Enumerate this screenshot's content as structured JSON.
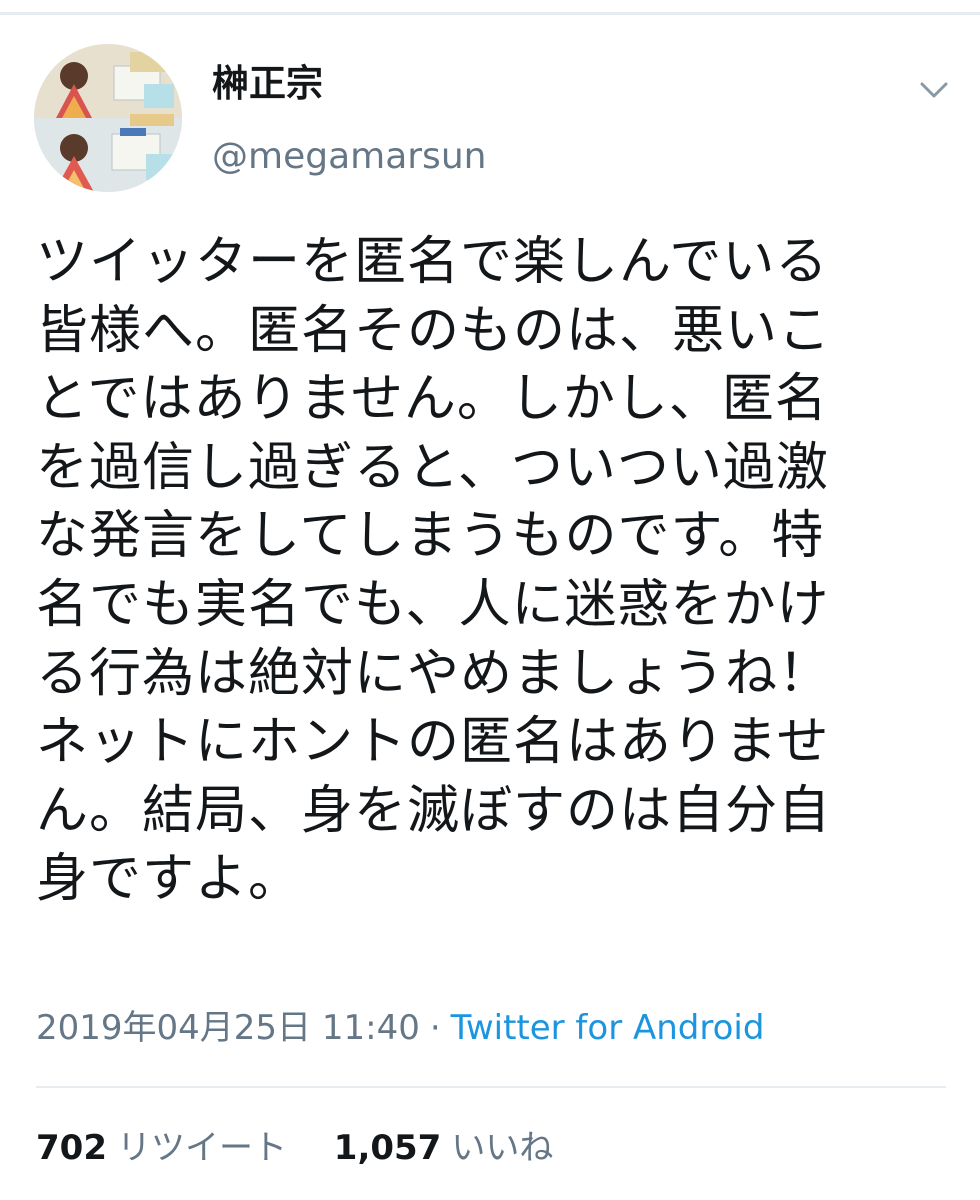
{
  "tweet": {
    "author": {
      "display_name": "榊正宗",
      "handle": "@megamarsun",
      "avatar_icon": "profile-avatar"
    },
    "body": "ツイッターを匿名で楽しんでいる\n皆様へ。匿名そのものは、悪いこ\nとではありません。しかし、匿名\nを過信し過ぎると、ついつい過激\nな発言をしてしまうものです。特\n名でも実名でも、人に迷惑をかけ\nる行為は絶対にやめましょうね！\nネットにホントの匿名はありませ\nん。結局、身を滅ぼすのは自分自\n身ですよ。",
    "timestamp": "2019年04月25日 11:40",
    "separator": "·",
    "source": "Twitter for Android",
    "stats": {
      "retweets": {
        "count": "702",
        "label": "リツイート"
      },
      "likes": {
        "count": "1,057",
        "label": "いいね"
      }
    },
    "menu_icon": "chevron-down-icon"
  },
  "colors": {
    "text_primary": "#14171a",
    "text_secondary": "#657786",
    "link": "#1b95e0",
    "divider": "#e6ecf0"
  }
}
